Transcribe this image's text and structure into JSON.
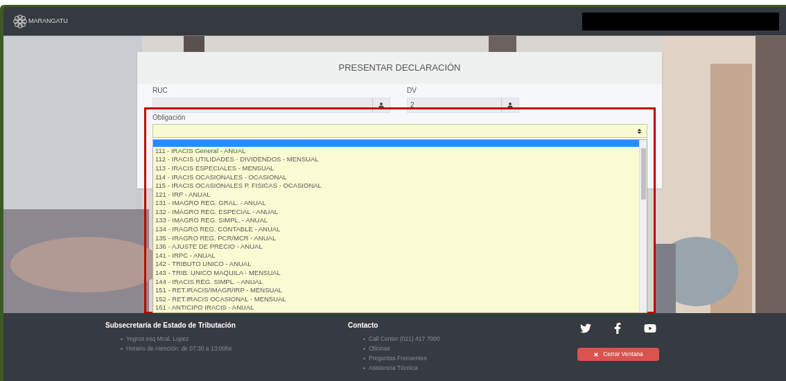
{
  "navbar": {
    "brand": "MARANGATU"
  },
  "card": {
    "title": "PRESENTAR DECLARACIÓN",
    "ruc": {
      "label": "RUC"
    },
    "dv": {
      "label": "DV",
      "value": "2"
    },
    "obligacion": {
      "label": "Obligación",
      "expanded": true,
      "blank_option_selected": true,
      "options": [
        {
          "label": "111 - IRACIS General - ANUAL",
          "selected": false
        },
        {
          "label": "112 - IRACIS UTILIDADES - DIVIDENDOS - MENSUAL",
          "selected": false
        },
        {
          "label": "113 - IRACIS ESPECIALES - MENSUAL",
          "selected": false
        },
        {
          "label": "114 - IRACIS OCASIONALES - OCASIONAL",
          "selected": false
        },
        {
          "label": "115 - IRACIS OCASIONALES P. FISICAS - OCASIONAL",
          "selected": false
        },
        {
          "label": "121 - IRP - ANUAL",
          "selected": false
        },
        {
          "label": "131 - IMAGRO REG. GRAL. - ANUAL",
          "selected": false
        },
        {
          "label": "132 - IMAGRO REG. ESPECIAL - ANUAL",
          "selected": false
        },
        {
          "label": "133 - IMAGRO REG. SIMPL. - ANUAL",
          "selected": false
        },
        {
          "label": "134 - IRAGRO REG. CONTABLE - ANUAL",
          "selected": false
        },
        {
          "label": "135 - IRAGRO REG. PCR/MCR - ANUAL",
          "selected": false
        },
        {
          "label": "136 - AJUSTE DE PRECIO - ANUAL",
          "selected": false
        },
        {
          "label": "141 - IRPC - ANUAL",
          "selected": false
        },
        {
          "label": "142 - TRIBUTO UNICO - ANUAL",
          "selected": false
        },
        {
          "label": "143 - TRIB. UNICO MAQUILA - MENSUAL",
          "selected": false
        },
        {
          "label": "144 - IRACIS REG. SIMPL. - ANUAL",
          "selected": false
        },
        {
          "label": "151 - RET.IRACIS/IMAGR/IRP - MENSUAL",
          "selected": false
        },
        {
          "label": "152 - RET.IRACIS OCASIONAL - MENSUAL",
          "selected": false
        },
        {
          "label": "161 - ANTICIPO IRACIS - ANUAL",
          "selected": false
        }
      ]
    }
  },
  "footer": {
    "columns": [
      {
        "title": "Subsecretaría de Estado de Tributación",
        "items": [
          "Yegros esq Mcal. Lopez",
          "Horario de Atención: de 07:30 a 13:00hs"
        ]
      },
      {
        "title": "Contacto",
        "items": [
          "Call Center (021) 417 7000",
          "Oficinas",
          "Preguntas Frecuentes",
          "Asistencia Técnica"
        ]
      }
    ],
    "close_button": "Cerrar Ventana"
  }
}
